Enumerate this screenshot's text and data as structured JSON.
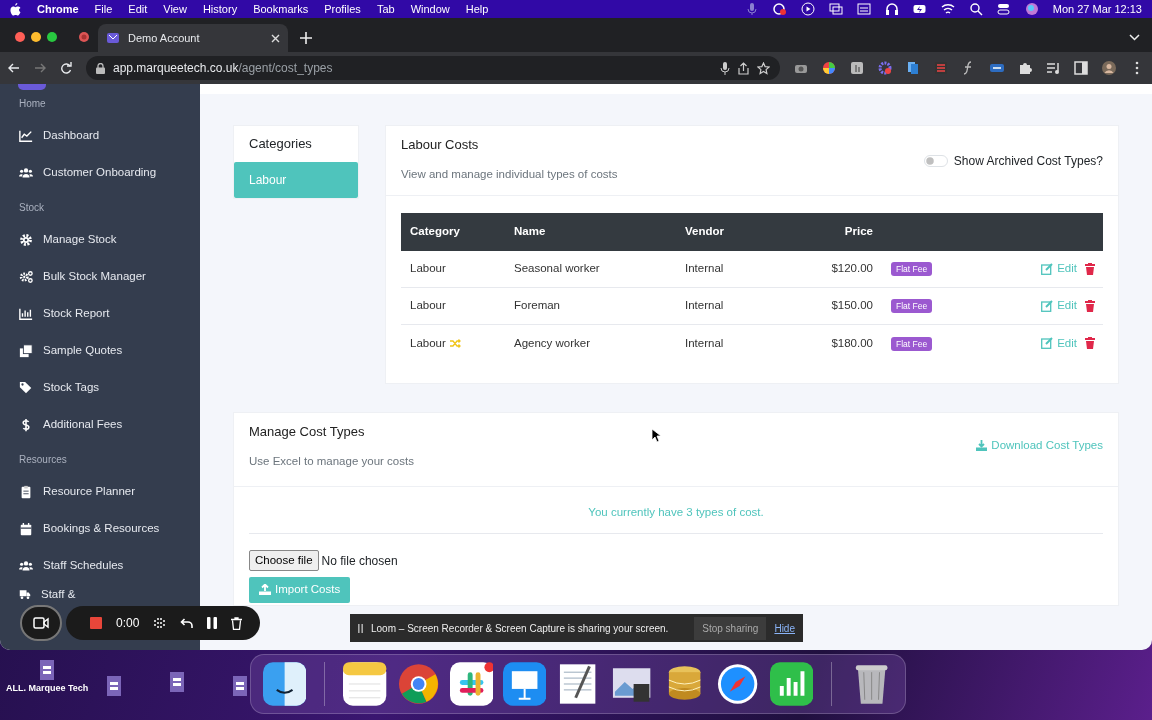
{
  "menubar": {
    "app": "Chrome",
    "menus": [
      "File",
      "Edit",
      "View",
      "History",
      "Bookmarks",
      "Profiles",
      "Tab",
      "Window",
      "Help"
    ],
    "clock": "Mon 27 Mar  12:13"
  },
  "browser": {
    "tab_title": "Demo Account",
    "url_host": "app.marqueetech.co.uk",
    "url_path": "/agent/cost_types"
  },
  "sidebar": {
    "sections": [
      {
        "heading": "Home",
        "items": [
          {
            "label": "Dashboard",
            "kind": "chart"
          },
          {
            "label": "Customer Onboarding",
            "kind": "users"
          }
        ]
      },
      {
        "heading": "Stock",
        "items": [
          {
            "label": "Manage Stock",
            "kind": "gear"
          },
          {
            "label": "Bulk Stock Manager",
            "kind": "gears"
          },
          {
            "label": "Stock Report",
            "kind": "bars"
          },
          {
            "label": "Sample Quotes",
            "kind": "copy"
          },
          {
            "label": "Stock Tags",
            "kind": "tags"
          },
          {
            "label": "Additional Fees",
            "kind": "dollar"
          }
        ]
      },
      {
        "heading": "Resources",
        "items": [
          {
            "label": "Resource Planner",
            "kind": "clipboard"
          },
          {
            "label": "Bookings & Resources",
            "kind": "calendar"
          },
          {
            "label": "Staff Schedules",
            "kind": "users"
          },
          {
            "label": "Staff &",
            "kind": "truck"
          }
        ]
      }
    ]
  },
  "categories": {
    "title": "Categories",
    "items": [
      {
        "label": "Labour",
        "selected": true
      }
    ]
  },
  "labour_costs": {
    "title": "Labour Costs",
    "subtitle": "View and manage individual types of costs",
    "archived_toggle": {
      "label": "Show Archived Cost Types?",
      "on": false
    },
    "table": {
      "columns": [
        "Category",
        "Name",
        "Vendor",
        "Price"
      ],
      "rows": [
        {
          "category": "Labour",
          "shuffle": false,
          "name": "Seasonal worker",
          "vendor": "Internal",
          "price": "$120.00",
          "badge": "Flat Fee",
          "action": "Edit"
        },
        {
          "category": "Labour",
          "shuffle": false,
          "name": "Foreman",
          "vendor": "Internal",
          "price": "$150.00",
          "badge": "Flat Fee",
          "action": "Edit"
        },
        {
          "category": "Labour",
          "shuffle": true,
          "name": "Agency worker",
          "vendor": "Internal",
          "price": "$180.00",
          "badge": "Flat Fee",
          "action": "Edit"
        }
      ]
    }
  },
  "manage_cost_types": {
    "title": "Manage Cost Types",
    "subtitle": "Use Excel to manage your costs",
    "download": "Download Cost Types",
    "count_message": "You currently have 3 types of cost.",
    "file_button": "Choose file",
    "file_status": "No file chosen",
    "import_button": "Import Costs"
  },
  "recorder": {
    "timer": "0:00",
    "message": "Loom – Screen Recorder & Screen Capture is sharing your screen.",
    "stop": "Stop sharing",
    "hide": "Hide"
  },
  "desktop": {
    "icon_label": "ALL. Marquee Tech"
  }
}
